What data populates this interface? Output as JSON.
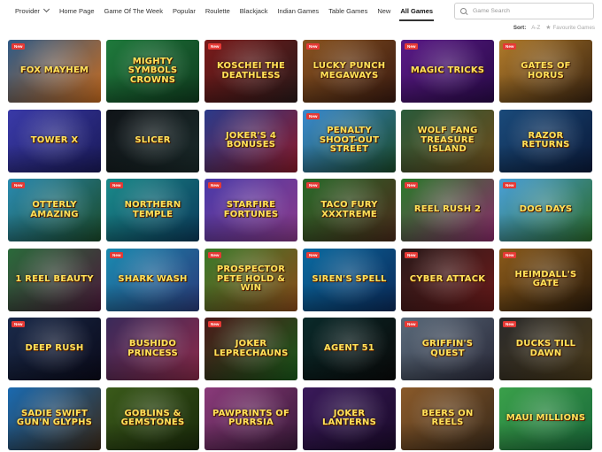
{
  "nav": {
    "provider_label": "Provider",
    "links": [
      "Home Page",
      "Game Of The Week",
      "Popular",
      "Roulette",
      "Blackjack",
      "Indian Games",
      "Table Games",
      "New",
      "All Games"
    ],
    "active": "All Games"
  },
  "search": {
    "placeholder": "Game Search"
  },
  "sort": {
    "label": "Sort:",
    "az": "A-Z",
    "favourites": "Favourite Games"
  },
  "badge_text": "New",
  "games": [
    {
      "title": "Fox Mayhem",
      "new": true,
      "color": "#2f5a86",
      "color2": "#c76b1e"
    },
    {
      "title": "Mighty Symbols Crowns",
      "new": false,
      "color": "#1f7a3c",
      "color2": "#0f3d1f"
    },
    {
      "title": "Koschei The Deathless",
      "new": true,
      "color": "#7a1a1a",
      "color2": "#2a1a1a"
    },
    {
      "title": "Lucky Punch Megaways",
      "new": true,
      "color": "#8a5420",
      "color2": "#3a1a10"
    },
    {
      "title": "Magic Tricks",
      "new": true,
      "color": "#5a1a86",
      "color2": "#2a0a4a"
    },
    {
      "title": "Gates of Horus",
      "new": true,
      "color": "#b07a2a",
      "color2": "#3a2410"
    },
    {
      "title": "Tower X",
      "new": false,
      "color": "#3a3aa8",
      "color2": "#1a1a5a"
    },
    {
      "title": "Slicer",
      "new": false,
      "color": "#101418",
      "color2": "#1a2a2a"
    },
    {
      "title": "Joker's 4 Bonuses",
      "new": false,
      "color": "#2a3a8a",
      "color2": "#8a1a2a"
    },
    {
      "title": "Penalty Shoot-Out Street",
      "new": true,
      "color": "#3a8ad0",
      "color2": "#1a4a2a"
    },
    {
      "title": "Wolf Fang Treasure Island",
      "new": false,
      "color": "#2a5a3a",
      "color2": "#6a4a1a"
    },
    {
      "title": "Razor Returns",
      "new": false,
      "color": "#1a4a7a",
      "color2": "#0a1a3a"
    },
    {
      "title": "Otterly Amazing",
      "new": true,
      "color": "#2a8ab0",
      "color2": "#1a4a2a"
    },
    {
      "title": "Northern Temple",
      "new": true,
      "color": "#1a8a8a",
      "color2": "#0a3a5a"
    },
    {
      "title": "Starfire Fortunes",
      "new": true,
      "color": "#4a3aa8",
      "color2": "#8a3a8a"
    },
    {
      "title": "Taco Fury XXXtreme",
      "new": true,
      "color": "#2a6a2a",
      "color2": "#4a2a1a"
    },
    {
      "title": "Reel Rush 2",
      "new": true,
      "color": "#2a7a2a",
      "color2": "#8a2a6a"
    },
    {
      "title": "Dog Days",
      "new": true,
      "color": "#4aa0d8",
      "color2": "#2a6a2a"
    },
    {
      "title": "1 Reel Beauty",
      "new": false,
      "color": "#2a6a3a",
      "color2": "#4a1a3a"
    },
    {
      "title": "Shark Wash",
      "new": true,
      "color": "#1a8ab0",
      "color2": "#2a3a7a"
    },
    {
      "title": "Prospector Pete Hold & Win",
      "new": true,
      "color": "#3a7a2a",
      "color2": "#8a4a1a"
    },
    {
      "title": "Siren's Spell",
      "new": true,
      "color": "#0a6aa0",
      "color2": "#0a2a5a"
    },
    {
      "title": "Cyber Attack",
      "new": true,
      "color": "#2a1a1a",
      "color2": "#6a1a1a"
    },
    {
      "title": "Heimdall's Gate",
      "new": true,
      "color": "#8a5a1a",
      "color2": "#2a1a0a"
    },
    {
      "title": "Deep Rush",
      "new": true,
      "color": "#1a2a4a",
      "color2": "#0a0a1a"
    },
    {
      "title": "Bushido Princess",
      "new": false,
      "color": "#3a2a5a",
      "color2": "#8a2a4a"
    },
    {
      "title": "Joker Leprechauns",
      "new": true,
      "color": "#4a1a1a",
      "color2": "#1a5a1a"
    },
    {
      "title": "Agent 51",
      "new": false,
      "color": "#0a2a2a",
      "color2": "#0a0a0a"
    },
    {
      "title": "Griffin's Quest",
      "new": true,
      "color": "#5a6a7a",
      "color2": "#2a2a3a"
    },
    {
      "title": "Ducks till Dawn",
      "new": true,
      "color": "#2a2a2a",
      "color2": "#4a3a1a"
    },
    {
      "title": "Sadie Swift Gun'n Glyphs",
      "new": false,
      "color": "#1a6ab0",
      "color2": "#3a2a1a"
    },
    {
      "title": "Goblins & Gemstones",
      "new": false,
      "color": "#3a5a1a",
      "color2": "#1a2a0a"
    },
    {
      "title": "Pawprints of Purrsia",
      "new": false,
      "color": "#8a3a7a",
      "color2": "#3a1a3a"
    },
    {
      "title": "Joker Lanterns",
      "new": false,
      "color": "#3a1a5a",
      "color2": "#1a0a2a"
    },
    {
      "title": "Beers on Reels",
      "new": false,
      "color": "#8a5a2a",
      "color2": "#3a2a1a"
    },
    {
      "title": "Maui Millions",
      "new": false,
      "color": "#3aa04a",
      "color2": "#1a6a3a"
    }
  ]
}
